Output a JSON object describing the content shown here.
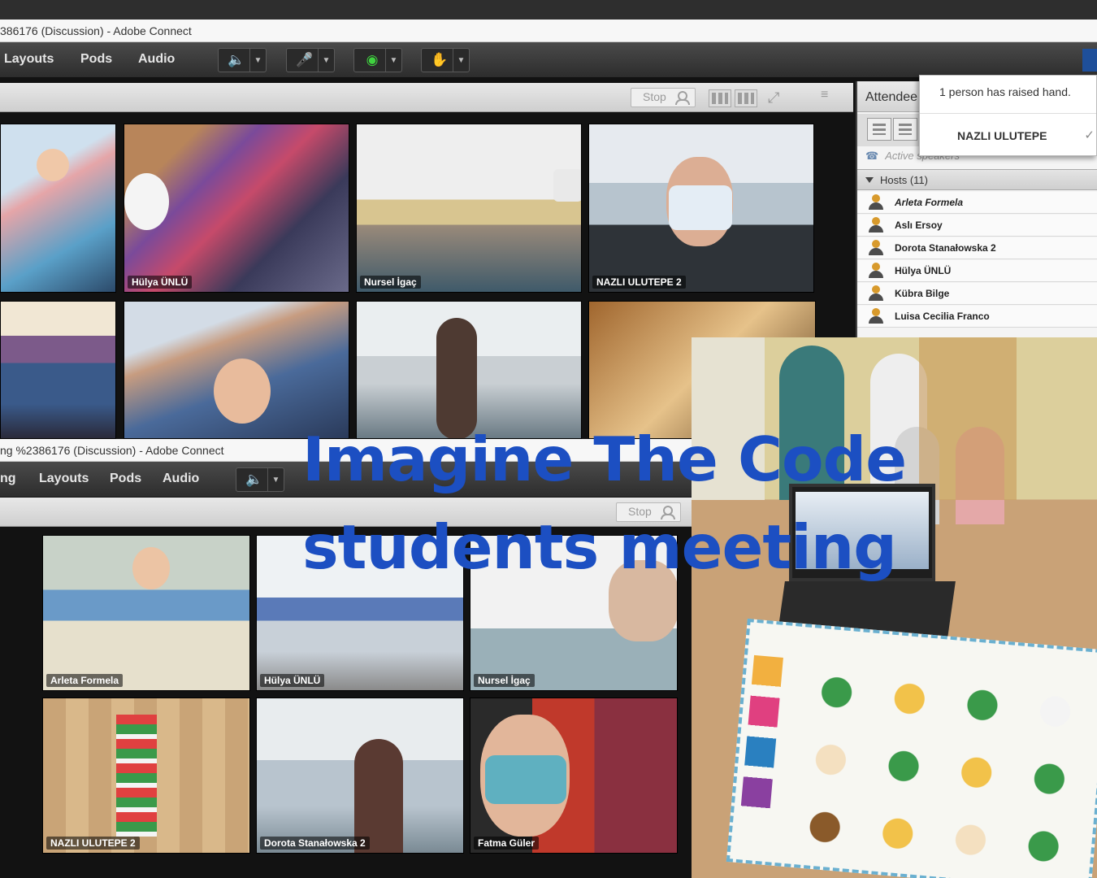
{
  "window_top": {
    "title": "386176 (Discussion) - Adobe Connect",
    "menu": [
      "Layouts",
      "Pods",
      "Audio"
    ],
    "stop_label": "Stop",
    "video_tiles": [
      {
        "name": ""
      },
      {
        "name": "Hülya ÜNLÜ"
      },
      {
        "name": "Nursel İgaç"
      },
      {
        "name": "NAZLI ULUTEPE 2"
      },
      {
        "name": ""
      },
      {
        "name": ""
      },
      {
        "name": ""
      },
      {
        "name": ""
      }
    ]
  },
  "attendees": {
    "header": "Attendee",
    "active_speakers": "Active speakers",
    "hosts_label": "Hosts (11)",
    "hosts": [
      "Arleta Formela",
      "Aslı Ersoy",
      "Dorota Stanałowska 2",
      "Hülya ÜNLÜ",
      "Kübra Bilge",
      "Luisa Cecilia Franco"
    ]
  },
  "raised_hand_popup": {
    "message": "1 person has raised hand.",
    "person": "NAZLI ULUTEPE"
  },
  "window_bottom": {
    "title": "ng %2386176 (Discussion) - Adobe Connect",
    "menu": [
      "ng",
      "Layouts",
      "Pods",
      "Audio"
    ],
    "stop_label": "Stop",
    "video_tiles": [
      {
        "name": "Arleta Formela"
      },
      {
        "name": "Hülya ÜNLÜ"
      },
      {
        "name": "Nursel İgaç"
      },
      {
        "name": "NAZLI ULUTEPE 2"
      },
      {
        "name": "Dorota Stanałowska 2"
      },
      {
        "name": "Fatma Güler"
      }
    ]
  },
  "headline": {
    "line1": "Imagine The Code",
    "line2": "students meeting"
  },
  "colors": {
    "headline": "#1c4fc2",
    "audio_active": "#3fd23f",
    "toolbar": "#3a3a3a"
  }
}
